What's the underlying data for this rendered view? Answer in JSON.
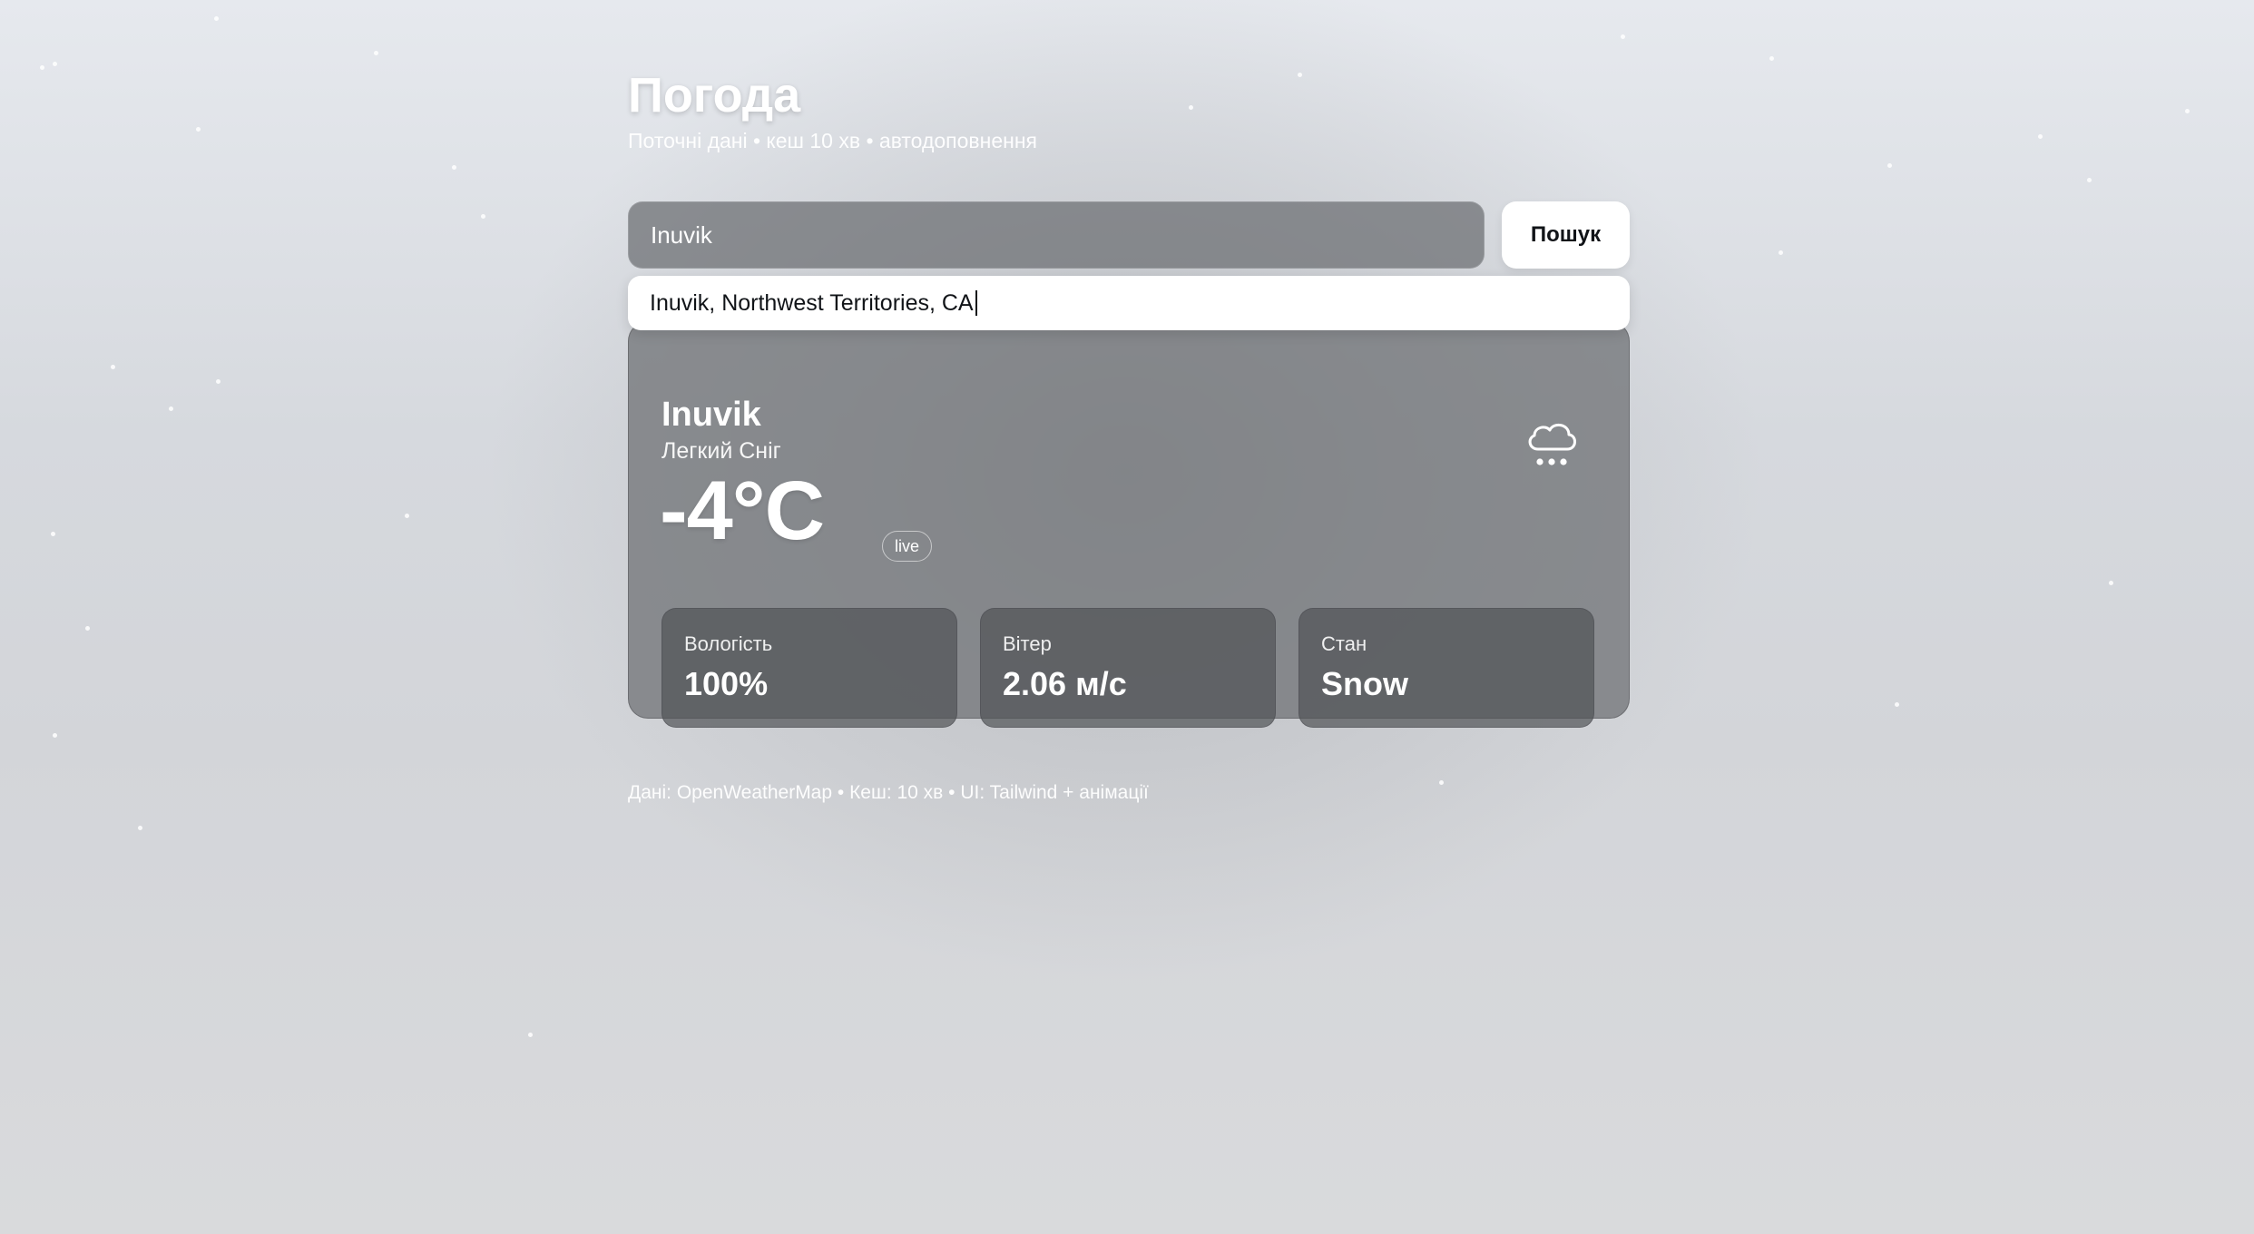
{
  "header": {
    "title": "Погода",
    "subtitle": "Поточні дані • кеш 10 хв • автодоповнення"
  },
  "search": {
    "value": "Inuvik",
    "button_label": "Пошук",
    "suggestion": "Inuvik, Northwest Territories, CA"
  },
  "weather": {
    "city": "Inuvik",
    "description": "Легкий Сніг",
    "icon": "snow-cloud-icon",
    "temperature": "-4°C",
    "live_label": "live",
    "stats": [
      {
        "label": "Вологість",
        "value": "100%"
      },
      {
        "label": "Вітер",
        "value": "2.06 м/с"
      },
      {
        "label": "Стан",
        "value": "Snow"
      }
    ]
  },
  "footer": {
    "text": "Дані: OpenWeatherMap • Кеш: 10 хв • UI: Tailwind + анімації"
  }
}
